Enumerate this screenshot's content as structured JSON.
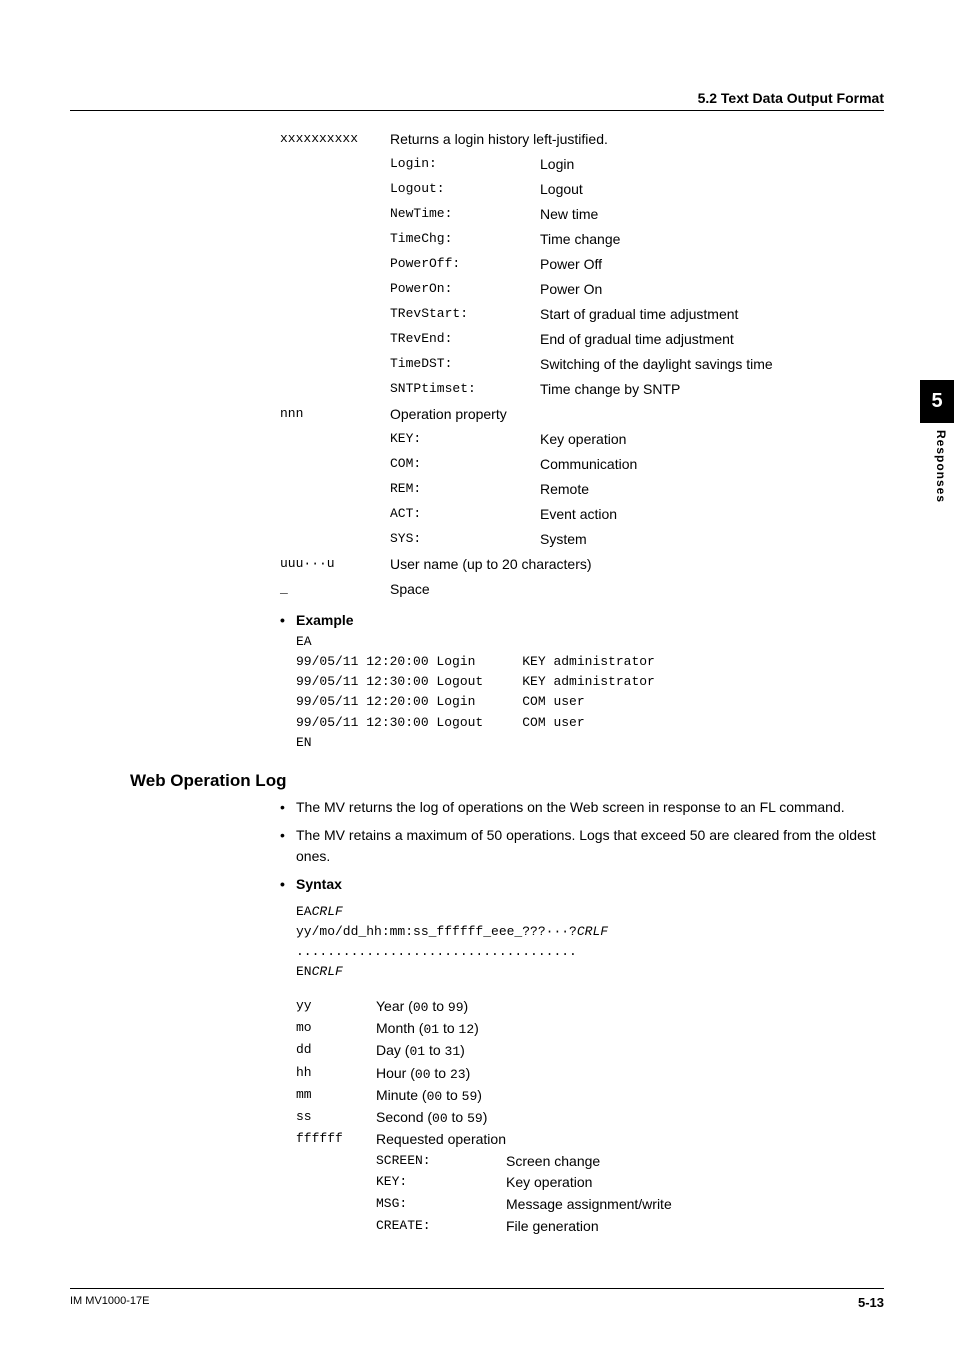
{
  "header": {
    "section": "5.2  Text Data Output Format"
  },
  "side": {
    "num": "5",
    "label": "Responses"
  },
  "table1": {
    "rows": [
      {
        "a": "xxxxxxxxxx",
        "b": "Returns a login history left-justified.",
        "c": ""
      }
    ],
    "sub": [
      {
        "b": "Login:",
        "c": "Login"
      },
      {
        "b": "Logout:",
        "c": "Logout"
      },
      {
        "b": "NewTime:",
        "c": "New time"
      },
      {
        "b": "TimeChg:",
        "c": "Time change"
      },
      {
        "b": "PowerOff:",
        "c": "Power Off"
      },
      {
        "b": "PowerOn:",
        "c": "Power On"
      },
      {
        "b": "TRevStart:",
        "c": "Start of gradual time adjustment"
      },
      {
        "b": "TRevEnd:",
        "c": "End of gradual time adjustment"
      },
      {
        "b": "TimeDST:",
        "c": "Switching of the daylight savings time"
      },
      {
        "b": "SNTPtimset:",
        "c": "Time change by SNTP"
      }
    ],
    "nnn_label": "nnn",
    "nnn_desc": "Operation property",
    "nnn_sub": [
      {
        "b": "KEY:",
        "c": "Key operation"
      },
      {
        "b": "COM:",
        "c": "Communication"
      },
      {
        "b": "REM:",
        "c": "Remote"
      },
      {
        "b": "ACT:",
        "c": "Event action"
      },
      {
        "b": "SYS:",
        "c": "System"
      }
    ],
    "uuu_label": "uuu···u",
    "uuu_desc": "User name (up to 20 characters)",
    "space_label": "_",
    "space_desc": "Space"
  },
  "example": {
    "title": "Example",
    "lines": [
      "EA",
      "99/05/11 12:20:00 Login      KEY administrator",
      "99/05/11 12:30:00 Logout     KEY administrator",
      "99/05/11 12:20:00 Login      COM user",
      "99/05/11 12:30:00 Logout     COM user",
      "EN"
    ]
  },
  "web": {
    "heading": "Web Operation Log",
    "bullets": [
      "The MV returns the log of operations on the Web screen in response to an FL command.",
      "The MV retains a maximum of 50 operations. Logs that exceed 50 are cleared from the oldest ones."
    ],
    "syntax_title": "Syntax",
    "syntax_lines": {
      "l1a": "EA",
      "l1b": "CRLF",
      "l2a": "yy/mo/dd_hh:mm:ss_ffffff_eee_???···?",
      "l2b": "CRLF",
      "l3": "....................................",
      "l4a": "EN",
      "l4b": "CRLF"
    },
    "defs": [
      {
        "a": "yy",
        "b": "Year (",
        "r1": "00",
        "mid": " to ",
        "r2": "99",
        "end": ")"
      },
      {
        "a": "mo",
        "b": "Month (",
        "r1": "01",
        "mid": " to ",
        "r2": "12",
        "end": ")"
      },
      {
        "a": "dd",
        "b": "Day (",
        "r1": "01",
        "mid": " to ",
        "r2": "31",
        "end": ")"
      },
      {
        "a": "hh",
        "b": "Hour (",
        "r1": "00",
        "mid": " to ",
        "r2": "23",
        "end": ")"
      },
      {
        "a": "mm",
        "b": "Minute (",
        "r1": "00",
        "mid": " to ",
        "r2": "59",
        "end": ")"
      },
      {
        "a": "ss",
        "b": "Second (",
        "r1": "00",
        "mid": " to ",
        "r2": "59",
        "end": ")"
      }
    ],
    "ff_label": "ffffff",
    "ff_desc": "Requested operation",
    "ff_sub": [
      {
        "b": "SCREEN:",
        "c": "Screen change"
      },
      {
        "b": "KEY:",
        "c": "Key operation"
      },
      {
        "b": "MSG:",
        "c": "Message assignment/write"
      },
      {
        "b": "CREATE:",
        "c": "File generation"
      }
    ]
  },
  "footer": {
    "left": "IM MV1000-17E",
    "right": "5-13"
  }
}
